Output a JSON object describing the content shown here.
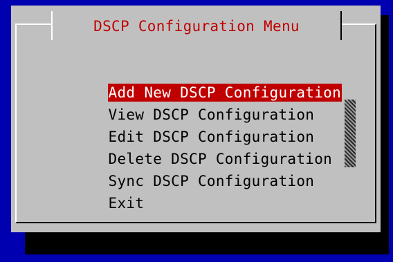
{
  "dialog": {
    "title": "DSCP Configuration Menu"
  },
  "menu": {
    "items": [
      {
        "label": "Add New DSCP Configuration",
        "selected": true
      },
      {
        "label": "View DSCP Configuration",
        "selected": false
      },
      {
        "label": "Edit DSCP Configuration",
        "selected": false
      },
      {
        "label": "Delete DSCP Configuration",
        "selected": false
      },
      {
        "label": "Sync DSCP Configuration",
        "selected": false
      },
      {
        "label": "Exit",
        "selected": false
      }
    ]
  },
  "colors": {
    "background": "#0000b0",
    "dialog": "#c0c0c0",
    "title_text": "#c00000",
    "selection": "#c00000",
    "shadow": "#000000"
  }
}
